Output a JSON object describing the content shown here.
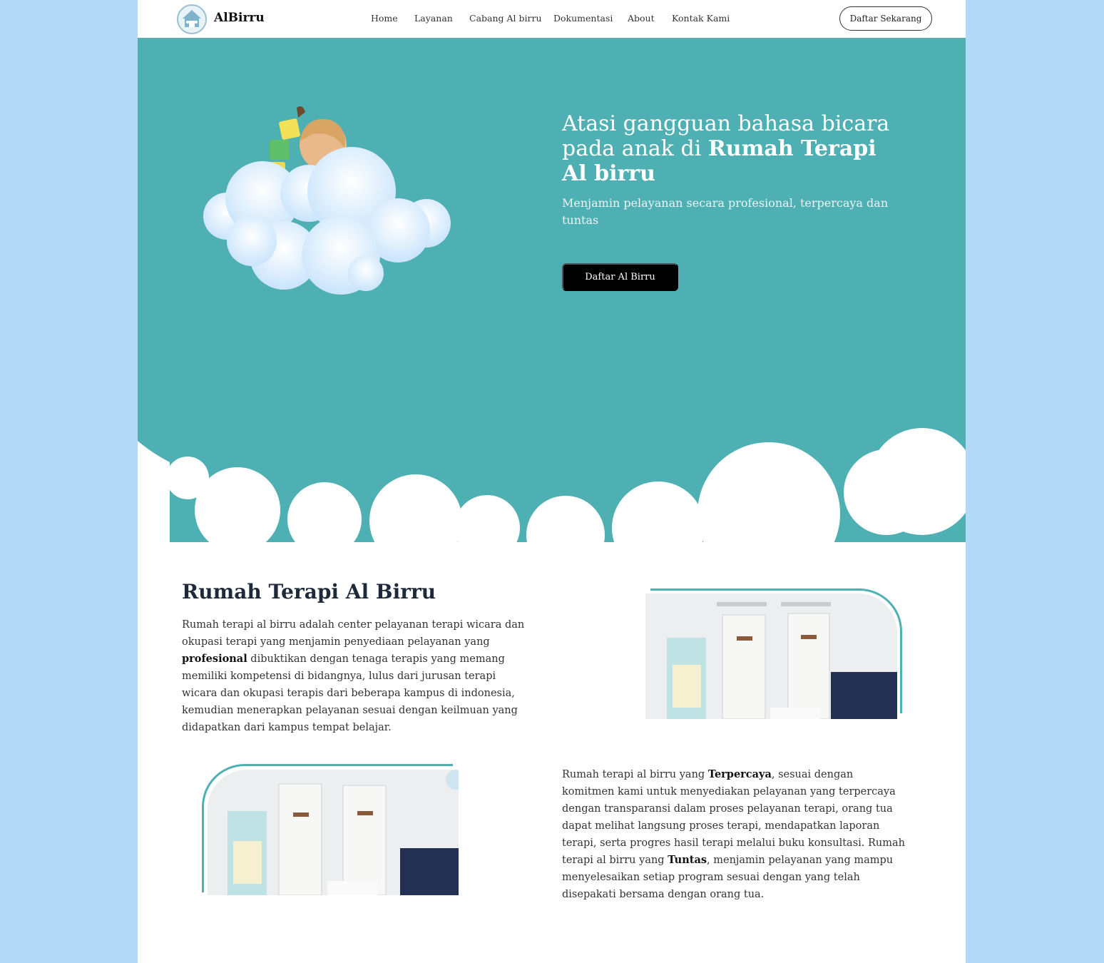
{
  "nav": {
    "brand": "AlBirru",
    "items": [
      "Home",
      "Layanan",
      "Cabang Al birru",
      "Dokumentasi",
      "About",
      "Kontak Kami"
    ],
    "cta": "Daftar Sekarang"
  },
  "hero": {
    "title_normal": "Atasi gangguan bahasa bicara pada anak di ",
    "title_bold": "Rumah Terapi Al birru",
    "subtitle": "Menjamin pelayanan secara profesional, terpercaya dan tuntas",
    "button": "Daftar Al Birru"
  },
  "about": {
    "heading": "Rumah Terapi Al Birru",
    "para1_a": "Rumah terapi al birru adalah center pelayanan terapi wicara dan okupasi terapi yang menjamin penyediaan pelayanan yang ",
    "para1_bold": "profesional",
    "para1_b": " dibuktikan dengan tenaga terapis yang memang memiliki kompetensi di bidangnya, lulus dari jurusan terapi wicara dan okupasi terapis dari beberapa kampus di indonesia, kemudian menerapkan pelayanan sesuai dengan keilmuan yang didapatkan dari kampus tempat belajar.",
    "para2_a": "Rumah terapi al birru yang ",
    "para2_bold1": "Terpercaya",
    "para2_b": ", sesuai dengan komitmen kami untuk menyediakan pelayanan yang terpercaya dengan transparansi dalam proses pelayanan terapi, orang tua dapat melihat langsung proses terapi, mendapatkan laporan terapi, serta progres hasil terapi melalui buku konsultasi. Rumah terapi al birru yang ",
    "para2_bold2": "Tuntas",
    "para2_c": ", menjamin pelayanan yang mampu menyelesaikan setiap program sesuai dengan yang telah disepakati bersama dengan orang tua."
  },
  "colors": {
    "page_bg": "#b3d9f7",
    "hero_bg": "#4fb0b3",
    "accent": "#4fb0b3",
    "button_dark": "#000000"
  },
  "icons": {
    "logo": "house-logo-icon",
    "hero_art": "child-cloud-blocks-illustration"
  }
}
